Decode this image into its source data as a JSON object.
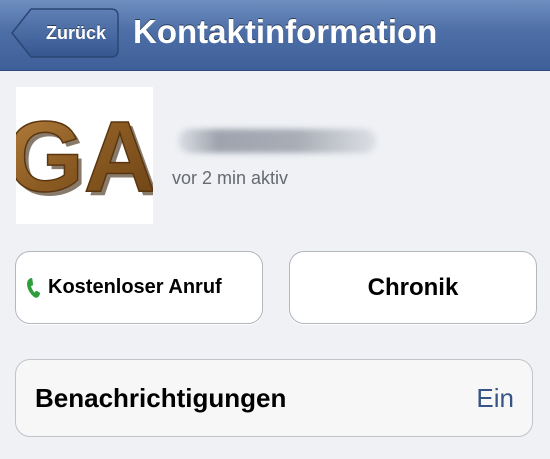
{
  "navbar": {
    "back_label": "Zurück",
    "title": "Kontaktinformation"
  },
  "contact": {
    "avatar_text": "GA",
    "status": "vor 2 min aktiv"
  },
  "actions": {
    "call_label": "Kostenloser Anruf",
    "chronik_label": "Chronik"
  },
  "settings": {
    "notifications_label": "Benachrichtigungen",
    "notifications_value": "Ein"
  },
  "colors": {
    "nav_bar": "#4d6ea6",
    "background": "#eff1f5",
    "phone_icon": "#2e9e3a",
    "value_blue": "#385487"
  },
  "icons": {
    "back": "chevron-left-icon",
    "call": "phone-icon"
  }
}
